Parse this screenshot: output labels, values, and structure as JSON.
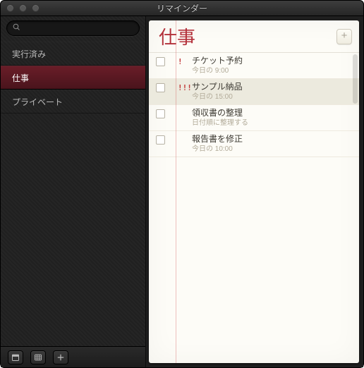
{
  "window": {
    "title": "リマインダー"
  },
  "search": {
    "value": "",
    "placeholder": ""
  },
  "sidebar": {
    "items": [
      {
        "label": "実行済み",
        "selected": false
      },
      {
        "label": "仕事",
        "selected": true
      },
      {
        "label": "プライベート",
        "selected": false
      }
    ]
  },
  "content": {
    "title": "仕事",
    "add_label": "+",
    "tasks": [
      {
        "priority": "!",
        "title": "チケット予約",
        "sub": "今日の 9:00",
        "selected": false
      },
      {
        "priority": "!!!",
        "title": "サンプル納品",
        "sub": "今日の 15:00",
        "selected": true
      },
      {
        "priority": "",
        "title": "領収書の整理",
        "sub": "日付順に整理する",
        "selected": false
      },
      {
        "priority": "",
        "title": "報告書を修正",
        "sub": "今日の 10:00",
        "selected": false
      }
    ]
  }
}
